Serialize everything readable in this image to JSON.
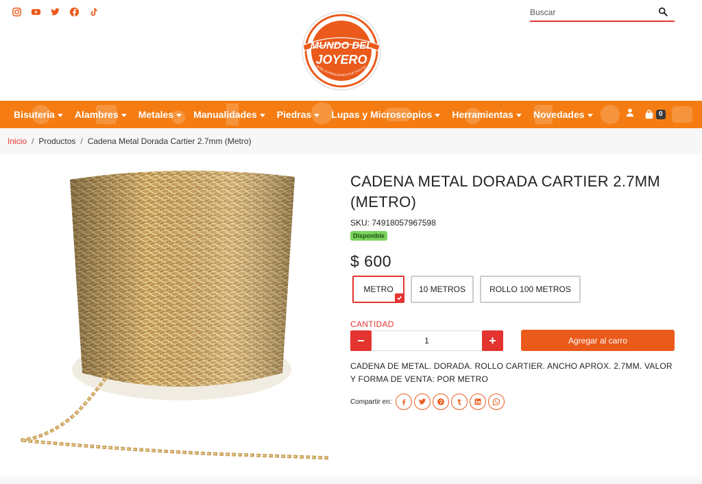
{
  "header": {
    "social_icons": [
      "instagram-icon",
      "youtube-icon",
      "twitter-icon",
      "facebook-icon",
      "tiktok-icon"
    ],
    "search": {
      "placeholder": "Buscar"
    },
    "logo": {
      "line1": "MUNDO DEL",
      "line2": "JOYERO",
      "tagline": "HACER JOYERIA NUNCA FUE TAN FACIL"
    }
  },
  "nav": {
    "items": [
      {
        "label": "Bisuteria"
      },
      {
        "label": "Alambres"
      },
      {
        "label": "Metales"
      },
      {
        "label": "Manualidades"
      },
      {
        "label": "Piedras"
      },
      {
        "label": "Lupas y Microscopios"
      },
      {
        "label": "Herramientas"
      },
      {
        "label": "Novedades"
      }
    ],
    "cart_count": "0"
  },
  "breadcrumb": {
    "home": "Inicio",
    "products": "Productos",
    "current": "Cadena Metal Dorada Cartier 2.7mm (Metro)",
    "separator": "/"
  },
  "product": {
    "title": "CADENA METAL DORADA CARTIER 2.7MM (METRO)",
    "sku": "SKU: 74918057967598",
    "availability": "Disponible",
    "price": "$ 600",
    "variants": [
      {
        "label": "METRO",
        "selected": true
      },
      {
        "label": "10 METROS",
        "selected": false
      },
      {
        "label": "ROLLO 100 METROS",
        "selected": false
      }
    ],
    "quantity_label": "CANTIDAD",
    "quantity": "1",
    "minus": "−",
    "plus": "+",
    "add_to_cart": "Agregar al carro",
    "description": "CADENA DE METAL. DORADA. ROLLO CARTIER. ANCHO APROX. 2.7MM. VALOR Y FORMA DE VENTA: POR METRO",
    "share_label": "Compartir en:",
    "share_icons": [
      "facebook-icon",
      "twitter-icon",
      "pinterest-icon",
      "tumblr-icon",
      "linkedin-icon",
      "whatsapp-icon"
    ]
  },
  "colors": {
    "accent_orange": "#f57c12",
    "button_orange": "#ea5a1b",
    "accent_red": "#e3342f",
    "available_green": "#7ad35c"
  }
}
